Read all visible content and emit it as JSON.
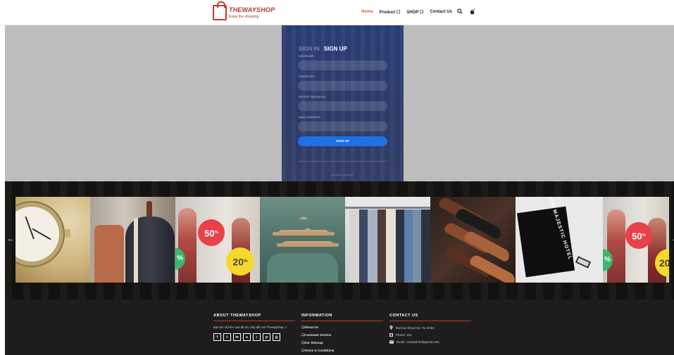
{
  "header": {
    "logo_title": "THEWAYSHOP",
    "logo_tagline": "Enjoy the shopping",
    "nav": [
      {
        "label": "Home"
      },
      {
        "label": "Product ☐"
      },
      {
        "label": "SHOP ☐"
      },
      {
        "label": "Contact Us"
      }
    ],
    "icons": [
      "search-icon",
      "cart-icon"
    ],
    "active_color": "#e05b3c"
  },
  "auth": {
    "tab_signin": "SIGN IN",
    "tab_signup": "SIGN UP",
    "username_label": "USERNAME",
    "password_label": "PASSWORD",
    "repeat_password_label": "REPEAT PASSWORD",
    "email_label": "EMAIL ADDRESS",
    "signup_button": "SIGN UP",
    "already_member": "Already Member?",
    "panel_color": "#2c3f7a",
    "button_color": "#1e6fe8"
  },
  "carousel": {
    "prev_arrow": "←",
    "next_arrow": "→",
    "badges": {
      "sale_50": "50",
      "sale_20": "20",
      "percent": "%"
    },
    "bag_print": "NEW MAJESTIC HOTEL"
  },
  "footer": {
    "about": {
      "heading": "ABOUT THEWAYSHOP",
      "text": "Bạn tìm về bên mua đồ xin. Hãy đến với Thewayshop. ×",
      "social_icons": [
        "facebook-icon",
        "twitter-icon",
        "linkedin-icon",
        "google-icon",
        "rss-icon",
        "pinterest-icon",
        "whatsapp-icon"
      ]
    },
    "information": {
      "heading": "INFORMATION",
      "links": [
        "☐About Us",
        "☐Customer Service",
        "☐Our Sitemap",
        "☐Terms & Conditions"
      ]
    },
    "contact": {
      "heading": "CONTACT US",
      "address": "Đại học Khoa học Tự nhiên",
      "phone": "Phone: 112",
      "email": "Email: contactinfo@gmail.com"
    },
    "accent_color": "#a8432f"
  }
}
